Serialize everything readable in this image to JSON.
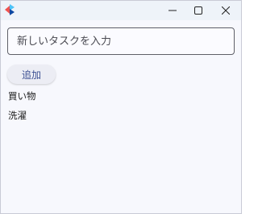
{
  "window": {
    "title": "",
    "icons": {
      "app": "app-logo-icon",
      "minimize": "minimize-icon",
      "maximize": "maximize-icon",
      "close": "close-icon"
    }
  },
  "task_input": {
    "value": "",
    "placeholder": "新しいタスクを入力"
  },
  "add_button": {
    "label": "追加"
  },
  "tasks": [
    {
      "label": "買い物"
    },
    {
      "label": "洗濯"
    }
  ],
  "colors": {
    "accent": "#3b4f92",
    "window_bg": "#f7f8fd",
    "titlebar_bg": "#eef3f9"
  }
}
